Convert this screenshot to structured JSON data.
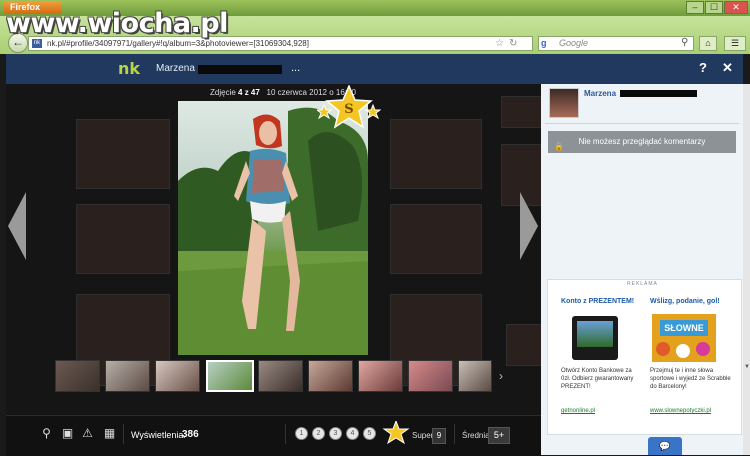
{
  "browser": {
    "firefox_button": "Firefox",
    "url_prefix": "nk.pl",
    "url_text": "nk.pl/#profile/34097971/gallery#!q/album=3&photoviewer=[31069304,928]",
    "search_placeholder": "Google",
    "window_controls": [
      "–",
      "☐",
      "✕"
    ]
  },
  "watermark": "www.wiocha.pl",
  "header": {
    "logo": "nk",
    "profile_name": "Marzena",
    "more": "...",
    "help": "?",
    "close": "✕"
  },
  "viewer": {
    "photo_label": "Zdjęcie",
    "photo_index": "4 z 47",
    "photo_date": "10 czerwca 2012 o 16:20",
    "super_badge_letter": "S",
    "views_label": "Wyświetlenia:",
    "views": "386",
    "rating_values": [
      "1",
      "2",
      "3",
      "4",
      "5"
    ],
    "super_label": "Super",
    "super_count": "9",
    "average_label": "Średnia:",
    "average_value": "5+",
    "next_thumbs": "›"
  },
  "sidebar": {
    "profile_name": "Marzena",
    "comments_notice": "Nie możesz przeglądać komentarzy",
    "ad_label": "REKLAMA",
    "ad1": {
      "title": "Konto z PREZENTEM!",
      "text": "Otwórz Konto Bankowe za 0zł. Odbierz gwarantowany PREZENT!",
      "link": "getnonline.pl"
    },
    "ad2": {
      "title": "Wślizg, podanie, gol!",
      "text": "Przejmuj te i inne słowa sportowe i wyjedź ze Scrabble do Barcelony!",
      "link": "www.slownepotyczki.pl"
    }
  },
  "icons": {
    "zoom": "magnifier-icon",
    "fit": "fit-screen-icon",
    "report": "warning-icon",
    "set_avatar": "picture-icon"
  }
}
